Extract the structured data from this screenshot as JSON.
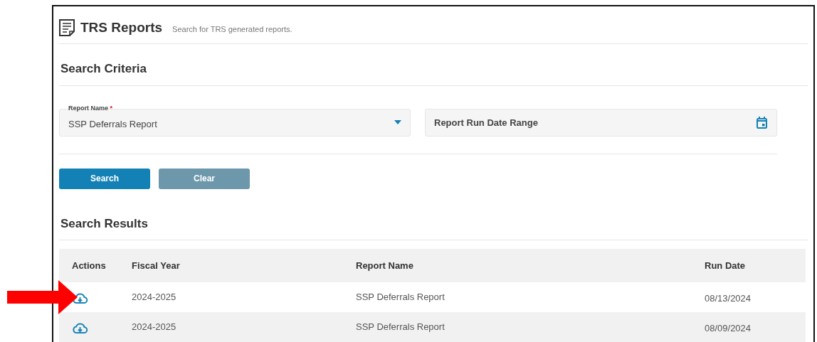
{
  "header": {
    "title": "TRS Reports",
    "subtitle": "Search for TRS generated reports."
  },
  "criteria": {
    "heading": "Search Criteria",
    "report_name": {
      "label": "Report Name",
      "required_mark": "*",
      "value": "SSP Deferrals Report"
    },
    "date_range": {
      "placeholder": "Report Run Date Range"
    }
  },
  "buttons": [
    {
      "label": "Search",
      "kind": "primary"
    },
    {
      "label": "Clear",
      "kind": "secondary"
    }
  ],
  "results": {
    "heading": "Search Results",
    "columns": [
      "Actions",
      "Fiscal Year",
      "Report Name",
      "Run Date"
    ],
    "rows": [
      {
        "fiscal_year": "2024-2025",
        "report_name": "SSP Deferrals Report",
        "run_date": "08/13/2024",
        "pointed": true
      },
      {
        "fiscal_year": "2024-2025",
        "report_name": "SSP Deferrals Report",
        "run_date": "08/09/2024",
        "pointed": false
      }
    ]
  }
}
